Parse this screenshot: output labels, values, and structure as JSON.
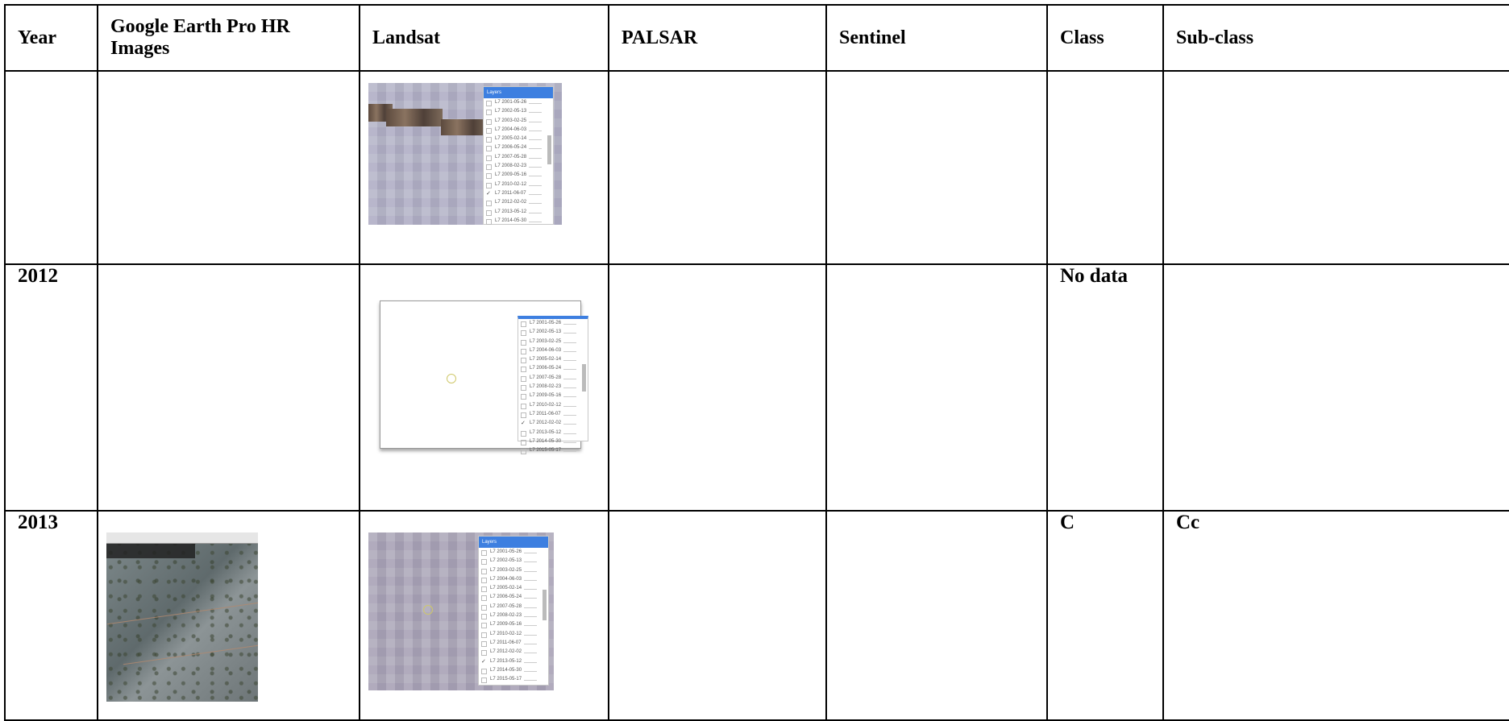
{
  "headers": [
    "Year",
    "Google Earth Pro HR Images",
    "Landsat",
    "PALSAR",
    "Sentinel",
    "Class",
    "Sub-class"
  ],
  "rows": [
    {
      "year": "",
      "class": "",
      "subclass": ""
    },
    {
      "year": "2012",
      "class": "No data",
      "subclass": ""
    },
    {
      "year": "2013",
      "class": "C",
      "subclass": "Cc"
    }
  ],
  "layers_panel": {
    "title": "Layers",
    "items": [
      "L7 2001-05-26",
      "L7 2002-05-13",
      "L7 2003-02-25",
      "L7 2004-06-03",
      "L7 2005-02-14",
      "L7 2006-05-24",
      "L7 2007-05-28",
      "L7 2008-02-23",
      "L7 2009-05-16",
      "L7 2010-02-12",
      "L7 2011-06-07",
      "L7 2012-02-02",
      "L7 2013-05-12",
      "L7 2014-05-30",
      "L7 2015-05-17"
    ],
    "checked_row1": "L7 2011-06-07",
    "checked_row2": "L7 2012-02-02",
    "checked_row3": "L7 2013-05-12"
  }
}
